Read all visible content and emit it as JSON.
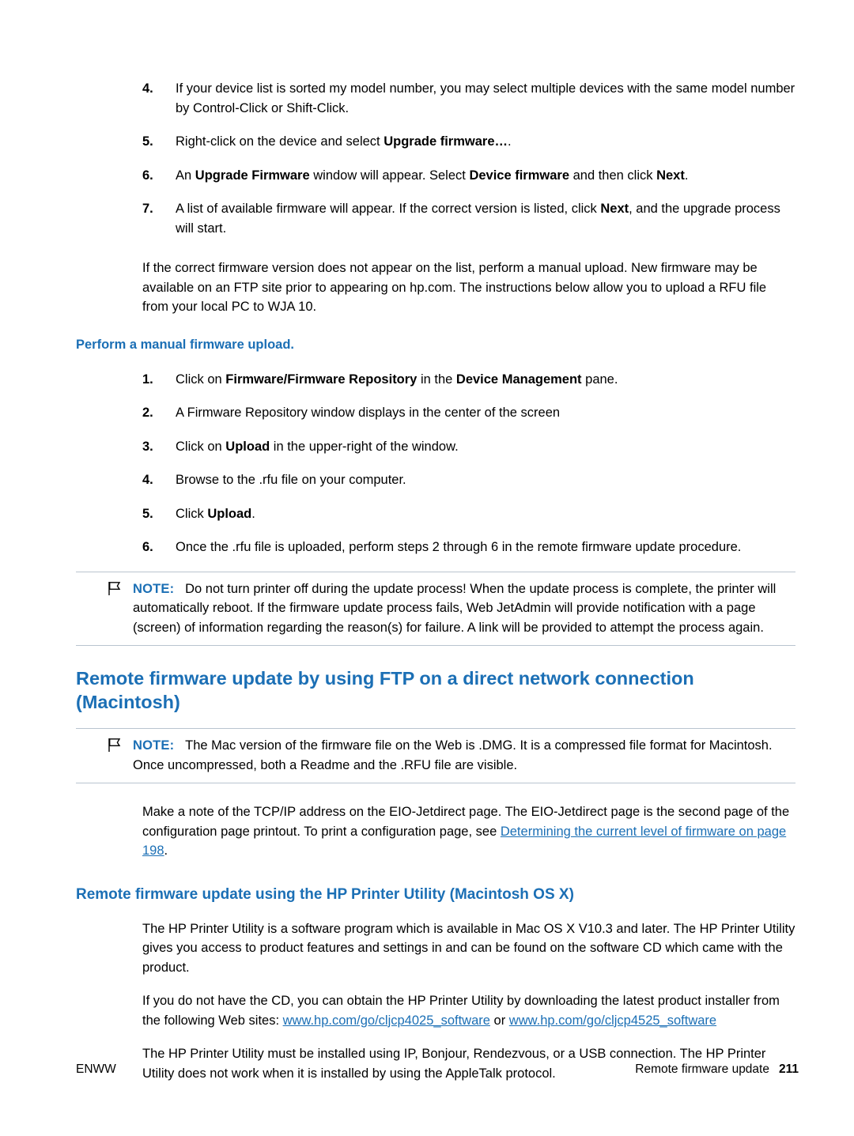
{
  "document": {
    "steps_top": [
      {
        "num": "4.",
        "parts": [
          {
            "text": "If your device list is sorted my model number, you may select multiple devices with the same model number by Control-Click or Shift-Click.",
            "bold": false
          }
        ]
      },
      {
        "num": "5.",
        "parts": [
          {
            "text": "Right-click on the device and select ",
            "bold": false
          },
          {
            "text": "Upgrade firmware…",
            "bold": true
          },
          {
            "text": ".",
            "bold": false
          }
        ]
      },
      {
        "num": "6.",
        "parts": [
          {
            "text": "An ",
            "bold": false
          },
          {
            "text": "Upgrade Firmware",
            "bold": true
          },
          {
            "text": " window will appear. Select ",
            "bold": false
          },
          {
            "text": "Device firmware",
            "bold": true
          },
          {
            "text": " and then click ",
            "bold": false
          },
          {
            "text": "Next",
            "bold": true
          },
          {
            "text": ".",
            "bold": false
          }
        ]
      },
      {
        "num": "7.",
        "parts": [
          {
            "text": "A list of available firmware will appear. If the correct version is listed, click ",
            "bold": false
          },
          {
            "text": "Next",
            "bold": true
          },
          {
            "text": ", and the upgrade process will start.",
            "bold": false
          }
        ]
      }
    ],
    "paragraph_manual": "If the correct firmware version does not appear on the list, perform a manual upload. New firmware may be available on an FTP site prior to appearing on hp.com. The instructions below allow you to upload a RFU file from your local PC to WJA 10.",
    "manual_heading": "Perform a manual firmware upload.",
    "steps_manual": [
      {
        "num": "1.",
        "parts": [
          {
            "text": "Click on ",
            "bold": false
          },
          {
            "text": "Firmware/Firmware Repository",
            "bold": true
          },
          {
            "text": " in the ",
            "bold": false
          },
          {
            "text": "Device Management",
            "bold": true
          },
          {
            "text": " pane.",
            "bold": false
          }
        ]
      },
      {
        "num": "2.",
        "parts": [
          {
            "text": "A Firmware Repository window displays in the center of the screen",
            "bold": false
          }
        ]
      },
      {
        "num": "3.",
        "parts": [
          {
            "text": "Click on ",
            "bold": false
          },
          {
            "text": "Upload",
            "bold": true
          },
          {
            "text": " in the upper-right of the window.",
            "bold": false
          }
        ]
      },
      {
        "num": "4.",
        "parts": [
          {
            "text": "Browse to the .rfu file on your computer.",
            "bold": false
          }
        ]
      },
      {
        "num": "5.",
        "parts": [
          {
            "text": "Click ",
            "bold": false
          },
          {
            "text": "Upload",
            "bold": true
          },
          {
            "text": ".",
            "bold": false
          }
        ]
      },
      {
        "num": "6.",
        "parts": [
          {
            "text": "Once the .rfu file is uploaded, perform steps 2 through 6 in the remote firmware update procedure.",
            "bold": false
          }
        ]
      }
    ],
    "note1": {
      "label": "NOTE:",
      "text": "Do not turn printer off during the update process! When the update process is complete, the printer will automatically reboot. If the firmware update process fails, Web JetAdmin will provide notification with a page (screen) of information regarding the reason(s) for failure. A link will be provided to attempt the process again."
    },
    "chapter_heading_line1": "Remote firmware update by using FTP on a direct network connection",
    "chapter_heading_line2": "(Macintosh)",
    "note2": {
      "label": "NOTE:",
      "text": "The Mac version of the firmware file on the Web is .DMG. It is a compressed file format for Macintosh. Once uncompressed, both a Readme and the .RFU file are visible."
    },
    "paragraph_tcpip": {
      "lead": "Make a note of the TCP/IP address on the EIO-Jetdirect page. The EIO-Jetdirect page is the second page of the configuration page printout. To print a configuration page, see ",
      "link": "Determining the current level of firmware  on page 198",
      "tail": "."
    },
    "section_heading": "Remote firmware update using the HP Printer Utility (Macintosh OS X)",
    "paragraph_utility": "The HP Printer Utility is a software program which is available in Mac OS X V10.3 and later. The HP Printer Utility gives you access to product features and settings in and can be found on the software CD which came with the product.",
    "paragraph_download": {
      "lead": "If you do not have the CD, you can obtain the HP Printer Utility by downloading the latest product installer from the following Web sites: ",
      "link1": "www.hp.com/go/cljcp4025_software",
      "mid": " or ",
      "link2": "www.hp.com/go/cljcp4525_software",
      "tail": ""
    },
    "paragraph_install": "The HP Printer Utility must be installed using IP, Bonjour, Rendezvous, or a USB connection. The HP Printer Utility does not work when it is installed by using the AppleTalk protocol.",
    "footer": {
      "left": "ENWW",
      "right": "Remote firmware update",
      "page": "211"
    },
    "colors": {
      "accent": "#1b6fb5",
      "rule": "#b9c4cf"
    }
  }
}
